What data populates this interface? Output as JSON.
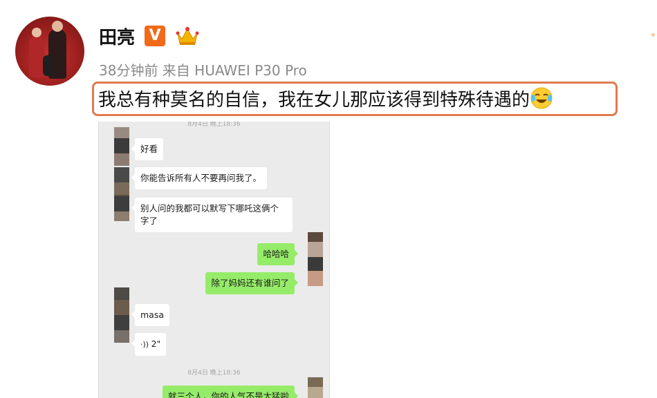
{
  "post": {
    "username": "田亮",
    "verified_badge": "V",
    "meta": "38分钟前 来自 HUAWEI P30 Pro",
    "content": "我总有种莫名的自信，我在女儿那应该得到特殊待遇的",
    "content_emoji": "laughing-crying-emoji",
    "highlight_color": "#e07a4d"
  },
  "chat": {
    "timestamp_top": "8月4日 晚上18:36",
    "messages": [
      {
        "side": "left",
        "text": "好看"
      },
      {
        "side": "left",
        "text": "你能告诉所有人不要再问我了。"
      },
      {
        "side": "left",
        "text": "别人问的我都可以默写下哪吒这俩个字了"
      },
      {
        "side": "right",
        "text": "哈哈哈"
      },
      {
        "side": "right",
        "text": "除了妈妈还有谁问了"
      },
      {
        "side": "left",
        "text": "masa"
      },
      {
        "side": "left",
        "text": "2\""
      }
    ],
    "timestamp_bottom": "8月4日 晚上18:36",
    "partial_message": "就三个人，你的人气不是太猛啦"
  }
}
